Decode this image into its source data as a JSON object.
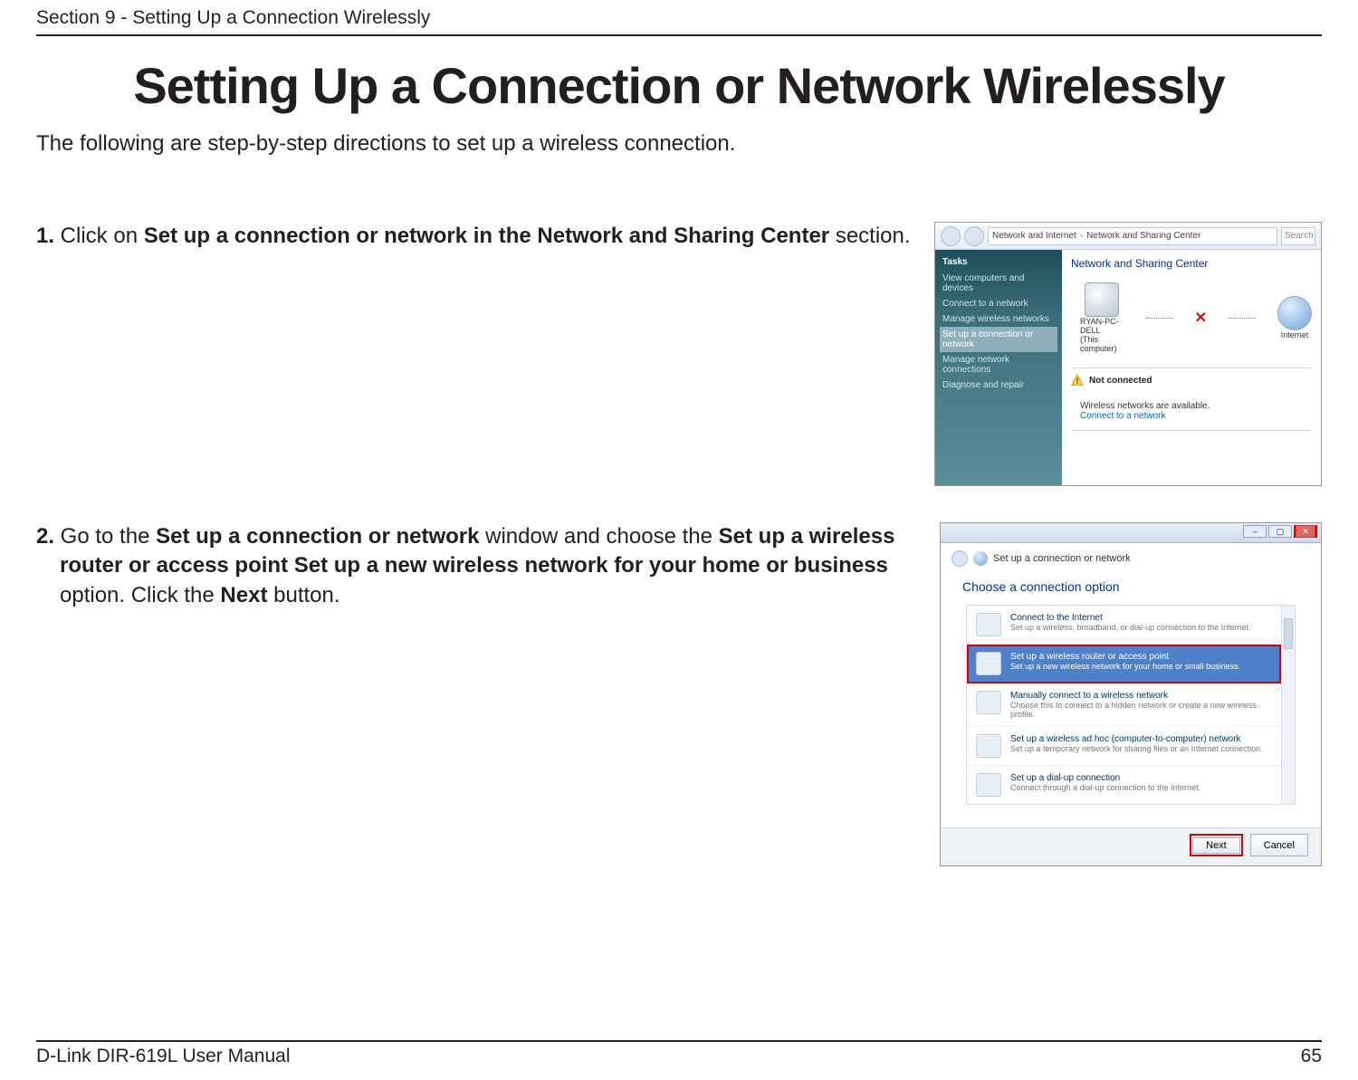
{
  "header": {
    "section_label": "Section 9 - Setting Up a Connection Wirelessly"
  },
  "title": "Setting Up a Connection or Network Wirelessly",
  "intro": "The following are step-by-step directions to set up a wireless connection.",
  "step1": {
    "num": "1.",
    "pre": " Click on ",
    "bold": "Set up a connection or network in the Network and Sharing Center",
    "post": " section."
  },
  "step2": {
    "num": "2.",
    "pre": " Go to the ",
    "bold1": "Set up a connection or network",
    "mid1": " window and choose the ",
    "bold2": "Set up a wireless router or access point Set up a new wireless network for your home or business",
    "mid2": "  option. Click the ",
    "bold3": "Next",
    "post": " button."
  },
  "ss1": {
    "breadcrumb": {
      "seg1": "Network and Internet",
      "seg2": "Network and Sharing Center"
    },
    "search_placeholder": "Search",
    "tasks_header": "Tasks",
    "tasks": [
      "View computers and devices",
      "Connect to a network",
      "Manage wireless networks",
      "Set up a connection or network",
      "Manage network connections",
      "Diagnose and repair"
    ],
    "main_heading": "Network and Sharing Center",
    "node_pc_line1": "RYAN-PC-DELL",
    "node_pc_line2": "(This computer)",
    "node_internet": "Internet",
    "not_connected": "Not connected",
    "wnet_msg": "Wireless networks are available.",
    "connect_link": "Connect to a network"
  },
  "ss2": {
    "window_title": "Set up a connection or network",
    "choose_heading": "Choose a connection option",
    "options": [
      {
        "title": "Connect to the Internet",
        "sub": "Set up a wireless, broadband, or dial-up connection to the Internet."
      },
      {
        "title": "Set up a wireless router or access point",
        "sub": "Set up a new wireless network for your home or small business."
      },
      {
        "title": "Manually connect to a wireless network",
        "sub": "Choose this to connect to a hidden network or create a new wireless profile."
      },
      {
        "title": "Set up a wireless ad hoc (computer-to-computer) network",
        "sub": "Set up a temporary network for sharing files or an Internet connection."
      },
      {
        "title": "Set up a dial-up connection",
        "sub": "Connect through a dial-up connection to the Internet."
      }
    ],
    "btn_next": "Next",
    "btn_cancel": "Cancel"
  },
  "footer": {
    "manual": "D-Link DIR-619L User Manual",
    "page": "65"
  }
}
